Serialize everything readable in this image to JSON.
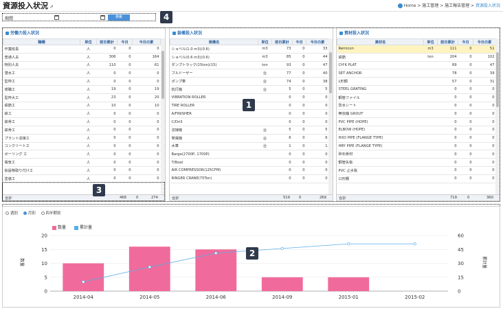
{
  "page": {
    "title": "資源投入状況",
    "title_ext": "⇗"
  },
  "breadcrumb": [
    "Home",
    "施工管理",
    "施工報告管理",
    "資源投入状況"
  ],
  "filter": {
    "label": "期間",
    "search_label": "検索"
  },
  "badges": [
    "1",
    "2",
    "3",
    "4"
  ],
  "labor": {
    "title": "労働力投入状況",
    "columns": [
      "職種",
      "単位",
      "前日累計",
      "今日",
      "今日の累"
    ],
    "rows": [
      [
        "作業班長",
        "人",
        "0",
        "0",
        "0"
      ],
      [
        "普通人夫",
        "人",
        "306",
        "0",
        "164"
      ],
      [
        "特別人夫",
        "人",
        "110",
        "0",
        "61"
      ],
      [
        "潜水工",
        "人",
        "0",
        "0",
        "0"
      ],
      [
        "型枠工",
        "人",
        "0",
        "0",
        "0"
      ],
      [
        "鳶職工",
        "人",
        "19",
        "0",
        "19"
      ],
      [
        "型枠大工",
        "人",
        "23",
        "0",
        "20"
      ],
      [
        "鉄筋工",
        "人",
        "10",
        "0",
        "10"
      ],
      [
        "鉄工",
        "人",
        "0",
        "0",
        "0"
      ],
      [
        "鉄骨工",
        "人",
        "0",
        "0",
        "0"
      ],
      [
        "鉄骨工",
        "人",
        "0",
        "0",
        "0"
      ],
      [
        "プラント溶接工",
        "人",
        "0",
        "0",
        "0"
      ],
      [
        "コンクリート工",
        "人",
        "0",
        "0",
        "0"
      ],
      [
        "ボーリング 工",
        "人",
        "0",
        "0",
        "0"
      ],
      [
        "電気工",
        "人",
        "0",
        "0",
        "0"
      ],
      [
        "仮設物取り付け工",
        "人",
        "0",
        "0",
        "0"
      ],
      [
        "塗装工",
        "人",
        "0",
        "0",
        "0"
      ]
    ],
    "total": {
      "label": "合計",
      "prev": "468",
      "today": "0",
      "cum": "274"
    }
  },
  "equipment": {
    "title": "装備投入状況",
    "columns": [
      "装備名",
      "単位",
      "前日累計",
      "今日",
      "今日の累"
    ],
    "rows": [
      [
        "ショベル(1.0 m3)(0.6)",
        "m3",
        "73",
        "0",
        "33"
      ],
      [
        "ショベル(0.6 m3)(0.6)",
        "m3",
        "85",
        "0",
        "44"
      ],
      [
        "ダンプトラック(15ton)(15)",
        "ton",
        "93",
        "0",
        "47"
      ],
      [
        "ブルドーザー",
        "台",
        "77",
        "0",
        "40"
      ],
      [
        "ポンプ車",
        "台",
        "74",
        "0",
        "38"
      ],
      [
        "杭打機",
        "台",
        "5",
        "0",
        "5"
      ],
      [
        "VIBRATION ROLLER",
        "",
        "0",
        "0",
        "0"
      ],
      [
        "TIRE ROLLER",
        "",
        "0",
        "0",
        "0"
      ],
      [
        "A/FINISHER",
        "",
        "0",
        "0",
        "0"
      ],
      [
        "C/Drill",
        "",
        "0",
        "0",
        "0"
      ],
      [
        "溶接機",
        "台",
        "5",
        "0",
        "5"
      ],
      [
        "発電機",
        "台",
        "6",
        "0",
        "6"
      ],
      [
        "水車",
        "台",
        "1",
        "0",
        "1"
      ],
      [
        "Barge(2700P, 1700P)",
        "",
        "0",
        "0",
        "0"
      ],
      [
        "T/Boat",
        "",
        "0",
        "0",
        "0"
      ],
      [
        "AIR COMPRESSOR(125CFM)",
        "",
        "0",
        "0",
        "0"
      ],
      [
        "RINGER CRANE(75Ton)",
        "",
        "0",
        "0",
        "0"
      ]
    ],
    "total": {
      "label": "合計",
      "prev": "519",
      "today": "0",
      "cum": "269"
    }
  },
  "material": {
    "title": "資材投入状況",
    "columns": [
      "資材名",
      "単位",
      "前日累計",
      "今日",
      "今日の累"
    ],
    "rows": [
      [
        "Remicon",
        "m3",
        "111",
        "0",
        "51"
      ],
      [
        "鉄筋",
        "ton",
        "204",
        "0",
        "102"
      ],
      [
        "CH'K PLAT",
        "",
        "89",
        "0",
        "47"
      ],
      [
        "SET ANCHOR",
        "",
        "78",
        "0",
        "39"
      ],
      [
        "L形鋼",
        "",
        "57",
        "0",
        "31"
      ],
      [
        "STEEL GRATING",
        "",
        "0",
        "0",
        "0"
      ],
      [
        "鋼管ファイル",
        "",
        "0",
        "0",
        "0"
      ],
      [
        "防水シート",
        "",
        "0",
        "0",
        "0"
      ],
      [
        "無収縮 GROUT",
        "",
        "0",
        "0",
        "0"
      ],
      [
        "PVC PIPE (HDPE)",
        "",
        "0",
        "0",
        "0"
      ],
      [
        "ELBOW (HDPE)",
        "",
        "0",
        "0",
        "0"
      ],
      [
        "HXD PIPE (FLANGE TYPE)",
        "",
        "0",
        "0",
        "0"
      ],
      [
        "HBY PIPE (FLANGE TYPE)",
        "",
        "0",
        "0",
        "0"
      ],
      [
        "砕石骨材",
        "",
        "0",
        "0",
        "0"
      ],
      [
        "鋼管矢板",
        "",
        "0",
        "0",
        "0"
      ],
      [
        "PVC 止水板",
        "",
        "0",
        "0",
        "0"
      ],
      [
        "ロ形鋼",
        "",
        "0",
        "0",
        "0"
      ]
    ],
    "total": {
      "label": "合計",
      "prev": "719",
      "today": "0",
      "cum": "360"
    }
  },
  "period_options": {
    "weekly": "週別",
    "monthly": "月別",
    "quarterly": "四半期別",
    "selected": "monthly"
  },
  "colors": {
    "bar": "#f06b9b",
    "line": "#5aaee8",
    "accent": "#4a90d9",
    "badge": "#2f3a4c"
  },
  "chart_data": {
    "type": "bar",
    "categories": [
      "2014-04",
      "2014-05",
      "2014-06",
      "2014-09",
      "2015-01",
      "2015-02"
    ],
    "series": [
      {
        "name": "数量",
        "type": "bar",
        "axis": "left",
        "values": [
          10,
          16,
          15,
          5,
          5,
          0
        ]
      },
      {
        "name": "累計量",
        "type": "line",
        "axis": "right",
        "values": [
          10,
          26,
          41,
          46,
          51,
          51
        ]
      }
    ],
    "ylabel": "数量",
    "y2label": "累計量",
    "ylim": [
      0,
      20
    ],
    "y2lim": [
      0,
      60
    ],
    "yticks": [
      0,
      5,
      10,
      15,
      20
    ],
    "y2ticks": [
      0,
      15,
      30,
      45,
      60
    ],
    "grid": true,
    "legend": "top-left"
  }
}
